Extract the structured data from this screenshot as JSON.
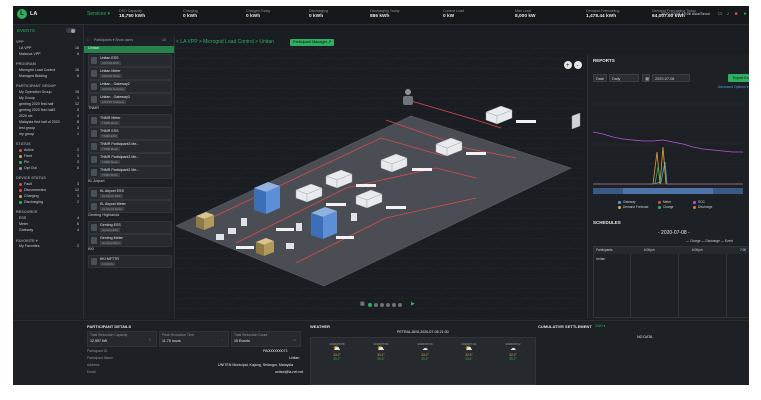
{
  "app": {
    "title": "LA",
    "breadcrumb": "Services ▾",
    "clock": "2020-07-08 19:06 Asia/Seoul",
    "colors": {
      "accent": "#2fae5f",
      "bg": "#1a1d21",
      "panel": "#1d2024"
    }
  },
  "stats": [
    {
      "label": "DSO Capacity",
      "value": "18,750 kWh"
    },
    {
      "label": "Charging",
      "value": "0 kWh"
    },
    {
      "label": "Charged Today",
      "value": "0 kWh"
    },
    {
      "label": "Discharging",
      "value": "0 kWh"
    },
    {
      "label": "Discharging Today",
      "value": "886 kWh"
    },
    {
      "label": "Current Load",
      "value": "0 kW"
    },
    {
      "label": "Max Load",
      "value": "8,000 kW"
    },
    {
      "label": "Demand Forecasting",
      "value": "1,478.44 kWh"
    },
    {
      "label": "Demand Forecasting Today",
      "value": "64,007.60 kWh"
    }
  ],
  "sidebar": {
    "title": "EVENTS",
    "vpp_head": "VPP",
    "vpp": [
      {
        "label": "LA VPP",
        "count": "16"
      },
      {
        "label": "Malacca VPP",
        "count": "6"
      }
    ],
    "program_head": "PROGRAM",
    "programs": [
      {
        "label": "Microgrid Load Control",
        "count": "16"
      },
      {
        "label": "Managed Bidding",
        "count": "6"
      }
    ],
    "group_head": "PARTICIPANT GROUP",
    "groups": [
      {
        "label": "My Operation Group",
        "count": "10"
      },
      {
        "label": "My Group",
        "count": "1"
      },
      {
        "label": "genting 2020 first half",
        "count": "12"
      },
      {
        "label": "genting 2020 first half2",
        "count": "5"
      },
      {
        "label": "2020 sfx",
        "count": "4"
      },
      {
        "label": "Malaysia first half of 2020",
        "count": "8"
      },
      {
        "label": "test group",
        "count": "3"
      },
      {
        "label": "my group",
        "count": "1"
      }
    ],
    "status_head": "STATUS",
    "status": [
      {
        "label": "Active",
        "count": "2",
        "color": "#d94b4b"
      },
      {
        "label": "Fleet",
        "count": "3",
        "color": "#e0a43c"
      },
      {
        "label": "Pin",
        "count": "3",
        "color": "#2fae5f"
      },
      {
        "label": "Opt Out",
        "count": "0",
        "color": "#8a939c"
      }
    ],
    "device_head": "DEVICE STATUS",
    "devices": [
      {
        "label": "Fault",
        "count": "3",
        "color": "#d94b4b"
      },
      {
        "label": "Disconnected",
        "count": "12",
        "color": "#d94b4b"
      },
      {
        "label": "Charging",
        "count": "3",
        "color": "#e0a43c"
      },
      {
        "label": "Discharging",
        "count": "2",
        "color": "#2fae5f"
      }
    ],
    "resource_head": "RESOURCE",
    "resources": [
      {
        "label": "ESS",
        "count": "4"
      },
      {
        "label": "Meter",
        "count": "6"
      },
      {
        "label": "Gateway",
        "count": "4"
      }
    ],
    "favorite_head": "FAVORITE ▾",
    "favorites": [
      {
        "label": "My Favorites",
        "count": "2"
      }
    ]
  },
  "participants": {
    "header": "Participants ▾   Show users",
    "count": "10",
    "groups": [
      {
        "name": "Unitan",
        "items": [
          {
            "name": "Unitan ESS",
            "sub": "UNITAN ESS"
          },
          {
            "name": "Unitan Meter",
            "sub": "UNITAN Meter"
          },
          {
            "name": "Unitan - Gateway2",
            "sub": "UNITAN Gateway"
          },
          {
            "name": "Unitan - Gateway3",
            "sub": "UNITAN Gateway"
          }
        ]
      },
      {
        "name": "TNMR",
        "items": [
          {
            "name": "TNMR Meter",
            "sub": "TNMR Meter"
          },
          {
            "name": "TNMR ESS",
            "sub": "TNMR ESS"
          },
          {
            "name": "TNMR Participant3 Me...",
            "sub": "TNMR Meter"
          },
          {
            "name": "TNMR Participant3 Me...",
            "sub": "TNMR Meter"
          },
          {
            "name": "TNMR Participant2 Me...",
            "sub": "TNMR Meter"
          }
        ]
      },
      {
        "name": "KL Airport",
        "items": [
          {
            "name": "KL Airport ESS",
            "sub": "KL Airport ESS"
          },
          {
            "name": "KL Airport Meter",
            "sub": "KL Airport Meter"
          }
        ]
      },
      {
        "name": "Genting Highlands",
        "items": [
          {
            "name": "Genting ESS",
            "sub": "Genting ESS"
          },
          {
            "name": "Genting Meter",
            "sub": "Genting Meter"
          }
        ]
      },
      {
        "name": "KKI",
        "items": [
          {
            "name": "KKI MFTTR",
            "sub": "KKI ESS"
          }
        ]
      }
    ]
  },
  "main": {
    "breadcrumb": "< LA VPP  >  Microgrid Load Control  >  Unitan",
    "pill": "Participant Manager ↗",
    "carousel_count": 6
  },
  "reports": {
    "title": "REPORTS",
    "date_label": "Date",
    "period": "Daily",
    "date": "2020-07-08",
    "export": "Export Excel",
    "advanced": "Advanced Options ▾",
    "legend": [
      {
        "label": "Gateway",
        "color": "#4aa3df"
      },
      {
        "label": "Meter",
        "color": "#d94b4b"
      },
      {
        "label": "SOC",
        "color": "#b05ad9"
      },
      {
        "label": "Demand Forecast",
        "color": "#e0a43c"
      },
      {
        "label": "Charge",
        "color": "#2fae5f"
      },
      {
        "label": "Discharge",
        "color": "#d97b3c"
      }
    ],
    "schedules_title": "SCHEDULES",
    "schedule_date": "- 2020-07-08 -",
    "schedule_legend": "— Charge  — Discharge  — Event",
    "schedule_cols": [
      "Participants",
      "6:00pm",
      "6:00pm",
      "7:00"
    ],
    "schedule_row": "Unitan"
  },
  "details": {
    "title": "PARTICIPANT DETAILS",
    "capacity_label": "Total Reduction Capacity",
    "capacity": "12,997 kW",
    "time_label": "Peak Reduction Time",
    "time": "11.75 hours",
    "events_label": "Total Reduction Count",
    "events": "15 Events",
    "id_label": "Participant ID",
    "id": "PA0000000073",
    "name_label": "Participant Name",
    "name": "Unitan",
    "address_label": "Address",
    "address": "UNITEN Municipal, Kajang, Selangor, Malaysia",
    "email_label": "Email",
    "email": "unitan@la-net.net"
  },
  "weather": {
    "title": "WEATHER",
    "location": "PETRALJAYA  2020-07-08 21:00",
    "days": [
      {
        "date": "2020/07/08",
        "icon": "cloud-sun",
        "hi": "33.0°",
        "lo": "25.1°"
      },
      {
        "date": "2020/07/09",
        "icon": "cloud-sun",
        "hi": "33.1°",
        "lo": "25.3°"
      },
      {
        "date": "2020/07/10",
        "icon": "cloud",
        "hi": "33.0°",
        "lo": "25.4°"
      },
      {
        "date": "2020/07/11",
        "icon": "cloud-sun",
        "hi": "32.5°",
        "lo": "25.4°"
      },
      {
        "date": "2020/07/12",
        "icon": "cloud",
        "hi": "32.0°",
        "lo": "25.2°"
      }
    ]
  },
  "settlement": {
    "title": "CUMULATIVE SETTLEMENT",
    "year": "2020 ▾",
    "empty": "NO DATA"
  }
}
